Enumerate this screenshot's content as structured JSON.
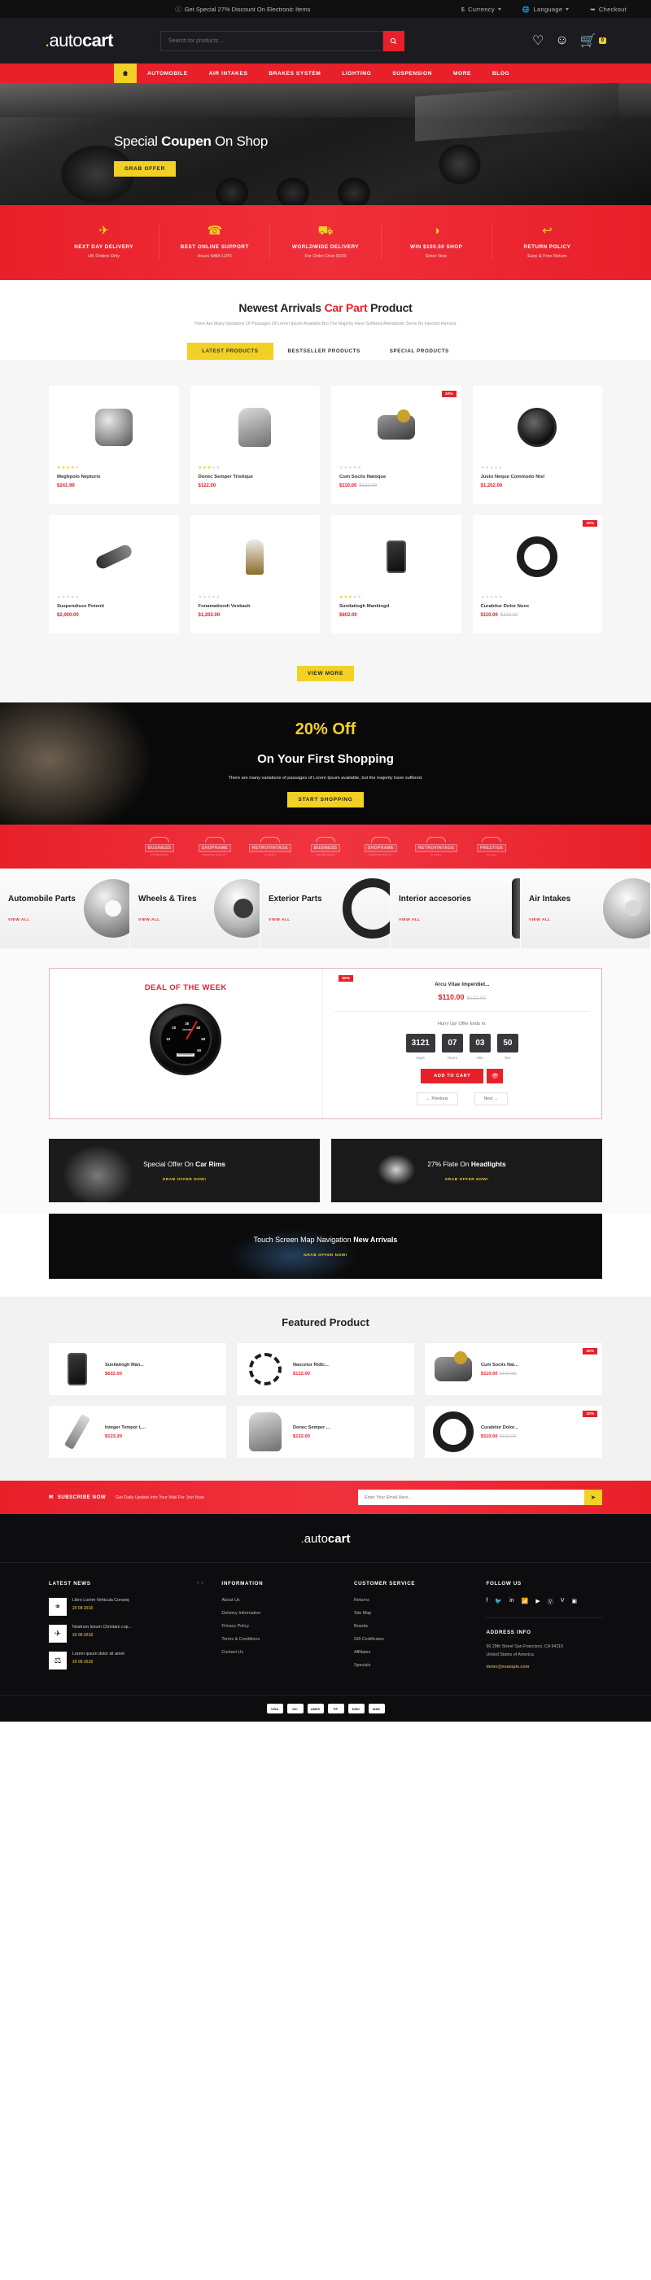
{
  "topbar": {
    "promo": "Get Special 27% Discount On Electronic Items",
    "currency": "Currency",
    "language": "Language",
    "checkout": "Checkout"
  },
  "header": {
    "logo_dot": ".",
    "logo_light": "auto",
    "logo_bold": "cart",
    "search_placeholder": "Search for products ...",
    "cart_count": "0"
  },
  "nav": {
    "items": [
      {
        "label": "AUTOMOBILE"
      },
      {
        "label": "AIR INTAKES"
      },
      {
        "label": "BRAKES SYSTEM"
      },
      {
        "label": "LIGHTING"
      },
      {
        "label": "SUSPENSION"
      },
      {
        "label": "MORE"
      },
      {
        "label": "BLOG"
      }
    ]
  },
  "hero": {
    "title_pre": "Special ",
    "title_bold": "Coupen",
    "title_post": " On Shop",
    "button": "GRAB OFFER"
  },
  "services": [
    {
      "icon": "rocket-icon",
      "glyph": "✈",
      "title": "NEXT DAY DELIVERY",
      "sub": "UK Orders Only"
    },
    {
      "icon": "headset-icon",
      "glyph": "☎",
      "title": "BEST ONLINE SUPPORT",
      "sub": "Hours 8AM-11PX"
    },
    {
      "icon": "truck-icon",
      "glyph": "⛟",
      "title": "WORLDWIDE DELIVERY",
      "sub": "For Order Over $100"
    },
    {
      "icon": "piggy-bank-icon",
      "glyph": "◑",
      "title": "WIN $100.50 SHOP",
      "sub": "Enter Now"
    },
    {
      "icon": "return-arrow-icon",
      "glyph": "↩",
      "title": "RETURN POLICY",
      "sub": "Easy & Free Return"
    }
  ],
  "arrivals": {
    "title_pre": "Newest Arrivals ",
    "title_accent": "Car Part",
    "title_post": " Product",
    "subtitle": "There Are Many Variations Of Passages Of Lorem Ipsum Available,But The Majority Have Suffered Alterationin Some By Injected Humour.",
    "tabs": [
      {
        "label": "LATEST PRODUCTS",
        "active": true
      },
      {
        "label": "BESTSELLER PRODUCTS",
        "active": false
      },
      {
        "label": "SPECIAL PRODUCTS",
        "active": false
      }
    ],
    "view_more": "VIEW MORE",
    "products": [
      {
        "name": "Meghpolo Nepturis",
        "price": "$241.99",
        "old_price": "",
        "stars": 4,
        "badge": "",
        "icon": "alternator-icon"
      },
      {
        "name": "Donec Semper Tristique",
        "price": "$122.00",
        "old_price": "",
        "stars": 3,
        "badge": "",
        "icon": "car-seat-icon"
      },
      {
        "name": "Cum Sociis Natoque",
        "price": "$110.00",
        "old_price": "$122.00",
        "stars": 0,
        "badge": "10%",
        "icon": "sensor-icon"
      },
      {
        "name": "Justo Neque Commodo Nisl",
        "price": "$1,202.00",
        "old_price": "",
        "stars": 0,
        "badge": "",
        "icon": "speaker-icon"
      },
      {
        "name": "Suspendisse Potenti",
        "price": "$2,000.00",
        "old_price": "",
        "stars": 0,
        "badge": "",
        "icon": "wrench-icon"
      },
      {
        "name": "Fonamationdi Venkash",
        "price": "$1,202.00",
        "old_price": "",
        "stars": 0,
        "badge": "",
        "icon": "bulb-icon"
      },
      {
        "name": "Sunilatiogh Mankingd",
        "price": "$602.00",
        "old_price": "",
        "stars": 3,
        "badge": "",
        "icon": "phone-holder-icon"
      },
      {
        "name": "Curabitur Dolor Nunc",
        "price": "$110.00",
        "old_price": "$122.00",
        "stars": 0,
        "badge": "10%",
        "icon": "steering-wheel-icon"
      }
    ]
  },
  "offer": {
    "discount": "20% Off",
    "heading": "On Your First Shopping",
    "text": "There are many variations of passages of Lorem Ipsum available, but the majority have suffered.",
    "button": "START SHOPPING"
  },
  "brands": [
    {
      "name": "BUSINESS",
      "sub": "ESTABLISHED"
    },
    {
      "name": "SHOPNAME",
      "sub": "PREMIUM QUALITY"
    },
    {
      "name": "RETROVINTAGE",
      "sub": "CLASSIC"
    },
    {
      "name": "BUSINESS",
      "sub": "ESTABLISHED"
    },
    {
      "name": "SHOPNAME",
      "sub": "PREMIUM QUALITY"
    },
    {
      "name": "RETROVINTAGE",
      "sub": "CLASSIC"
    },
    {
      "name": "PRESTIGE",
      "sub": "boutique"
    }
  ],
  "categories": [
    {
      "title": "Automobile Parts",
      "link": "VIEW ALL",
      "img": "brake-disc-icon"
    },
    {
      "title": "Wheels & Tires",
      "link": "VIEW ALL",
      "img": "wheel-icon"
    },
    {
      "title": "Exterior Parts",
      "link": "VIEW ALL",
      "img": "steering-wheel-icon"
    },
    {
      "title": "Interior accesories",
      "link": "VIEW ALL",
      "img": "shock-absorber-icon"
    },
    {
      "title": "Air Intakes",
      "link": "VIEW ALL",
      "img": "rim-icon"
    }
  ],
  "deal": {
    "badge": "50%",
    "heading": "DEAL OF THE WEEK",
    "product": "Arcu Vitae Imperdiet...",
    "price": "$110.00",
    "old_price": "$122.00",
    "hurry": "Hurry Up! Offer Ends in:",
    "countdown": [
      {
        "value": "3121",
        "label": "Days"
      },
      {
        "value": "07",
        "label": "Hours"
      },
      {
        "value": "03",
        "label": "Min"
      },
      {
        "value": "50",
        "label": "Sec"
      }
    ],
    "add_to_cart": "ADD TO CART",
    "previous": "← Previous",
    "next": "Next →",
    "gauge_numbers": [
      "10",
      "20",
      "30",
      "40",
      "50",
      "60"
    ],
    "gauge_unit": "X100 RPM",
    "gauge_odo": "000000"
  },
  "promos": [
    {
      "pre": "Special Offer On ",
      "bold": "Car Rims",
      "link": "GRAB OFFER NOW!"
    },
    {
      "pre": "27% Flate On ",
      "bold": "Headlights",
      "link": "GRAB OFFER NOW!"
    }
  ],
  "wide_promo": {
    "pre": "Touch Screen Map Navigation ",
    "bold": "New Arrivals",
    "link": "GRAB OFFER NOW!"
  },
  "featured": {
    "title": "Featured Product",
    "products": [
      {
        "name": "Sunilatiogh Man...",
        "price": "$602.00",
        "old_price": "",
        "badge": "",
        "icon": "phone-holder-icon"
      },
      {
        "name": "Nascetur Ridic...",
        "price": "$122.00",
        "old_price": "",
        "badge": "",
        "icon": "spring-icon"
      },
      {
        "name": "Cum Sociis Nat...",
        "price": "$110.00",
        "old_price": "$122.00",
        "badge": "10%",
        "icon": "sensor-icon"
      },
      {
        "name": "Integer Tempor L...",
        "price": "$123.20",
        "old_price": "",
        "badge": "",
        "icon": "spark-plug-icon"
      },
      {
        "name": "Donec Semper ...",
        "price": "$122.00",
        "old_price": "",
        "badge": "",
        "icon": "car-seat-icon"
      },
      {
        "name": "Curabitur Dolor...",
        "price": "$110.00",
        "old_price": "$122.00",
        "badge": "10%",
        "icon": "steering-wheel-icon"
      }
    ]
  },
  "newsletter": {
    "title": "SUBSCRIBE NOW",
    "subtitle": "Get Daily Update Into Your Mail For Join Now",
    "placeholder": "Enter Your Email Here..."
  },
  "footer": {
    "logo_dot": ".",
    "logo_light": "auto",
    "logo_bold": "cart",
    "latest_news": {
      "heading": "LATEST NEWS",
      "items": [
        {
          "title": "Libro Lorem Vehicula Conseq",
          "date": "20 08 2018"
        },
        {
          "title": "Nostrum Iesum Christam cop...",
          "date": "20 08 2018"
        },
        {
          "title": "Lorem ipsum dolor sit amet",
          "date": "20 08 2018"
        }
      ]
    },
    "information": {
      "heading": "INFORMATION",
      "links": [
        "About Us",
        "Delivery Information",
        "Privacy Policy",
        "Terms & Conditions",
        "Contact Us"
      ]
    },
    "customer_service": {
      "heading": "CUSTOMER SERVICE",
      "links": [
        "Returns",
        "Site Map",
        "Brands",
        "Gift Certificates",
        "Affiliates",
        "Specials"
      ]
    },
    "follow_us": {
      "heading": "FOLLOW US",
      "socials": [
        "facebook-icon",
        "twitter-icon",
        "linkedin-icon",
        "rss-icon",
        "youtube-icon",
        "pinterest-icon",
        "vimeo-icon",
        "instagram-icon"
      ],
      "address_heading": "ADDRESS INFO",
      "address_line1": "60 29th Street San Francisco, CA 94110",
      "address_line2": "United States of America",
      "email": "demo@example.com"
    },
    "payments": [
      "VISA",
      "MC",
      "AMEX",
      "PP",
      "DISC",
      "MAE"
    ]
  }
}
